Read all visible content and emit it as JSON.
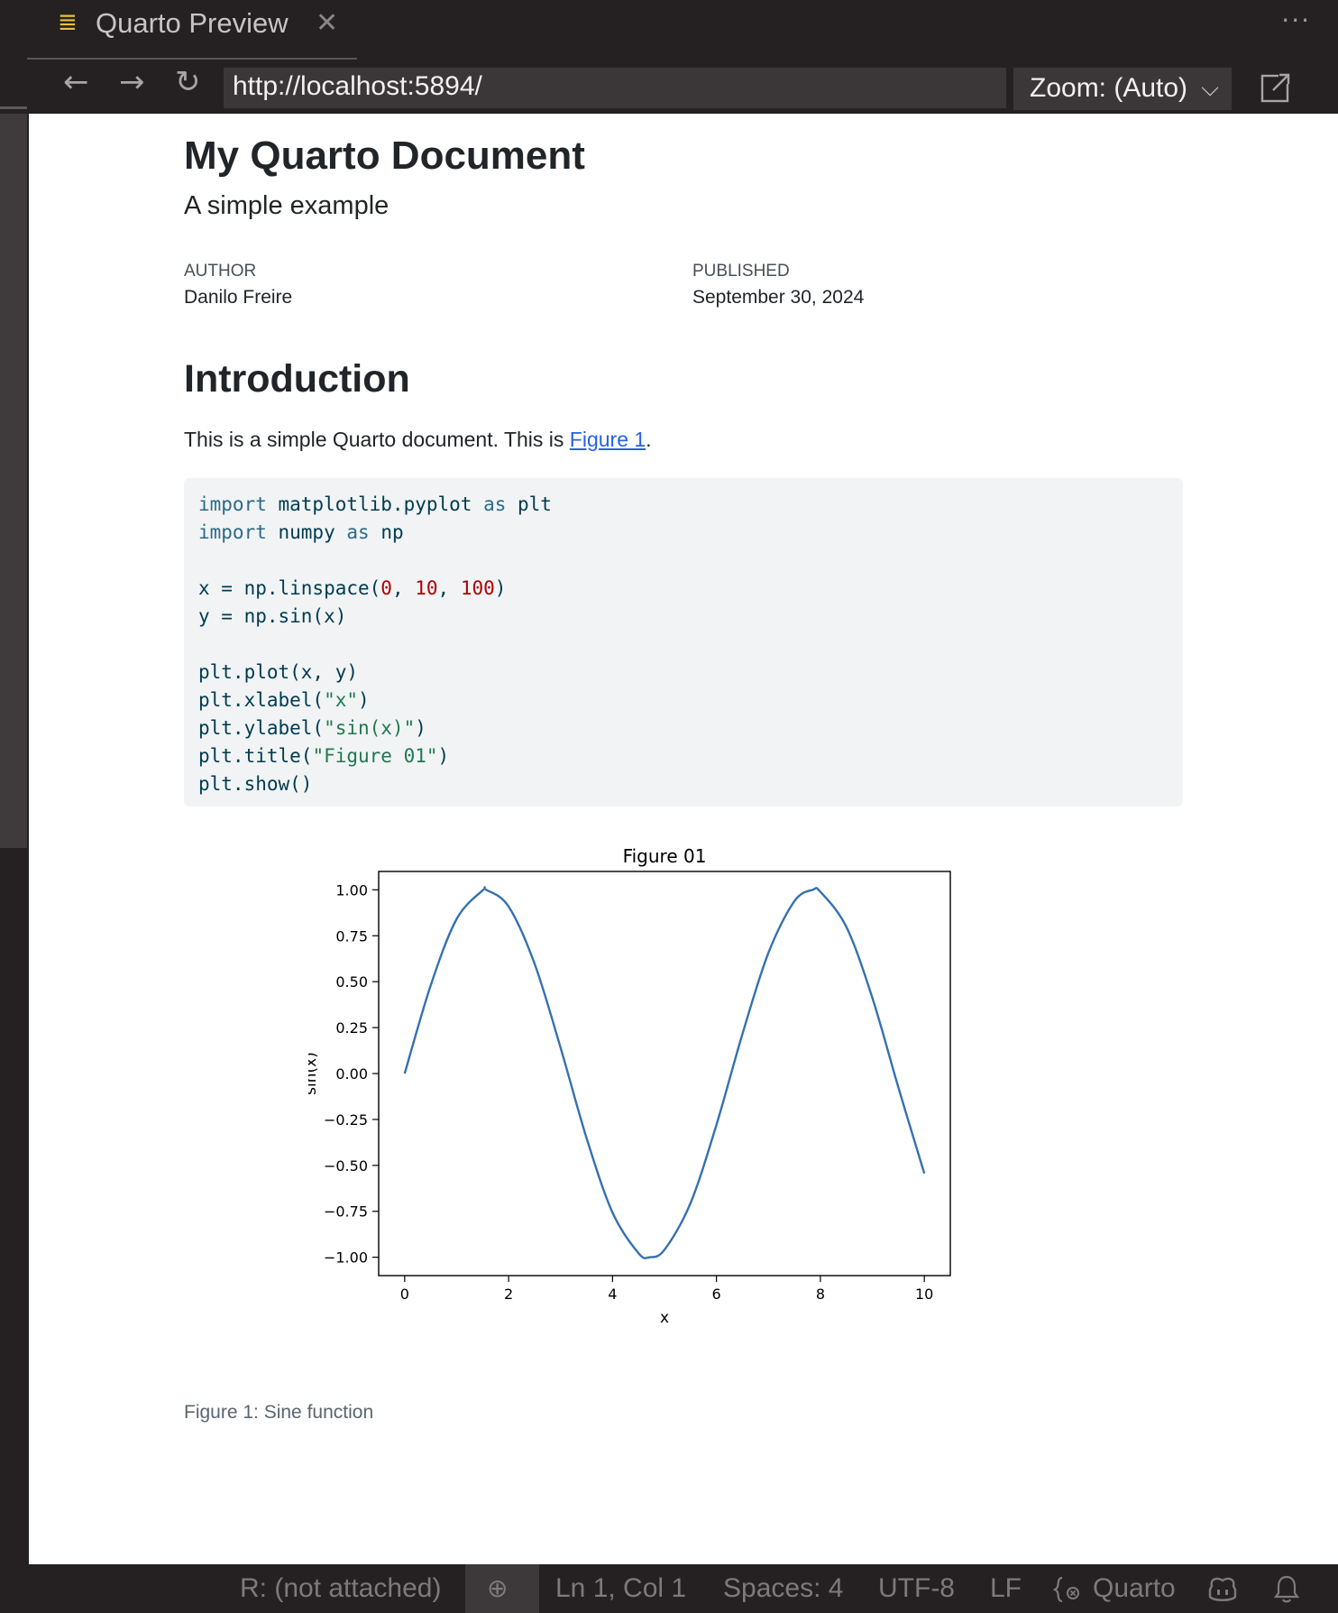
{
  "tab": {
    "icon": "menu-lines-icon",
    "title": "Quarto Preview",
    "close": "✕"
  },
  "toolbar": {
    "more": "···",
    "back": "←",
    "forward": "→",
    "reload": "↻",
    "url": "http://localhost:5894/",
    "zoom_label": "Zoom: (Auto)",
    "zoom_chevron": "⌵",
    "popout_icon": "open-external-icon"
  },
  "document": {
    "title": "My Quarto Document",
    "subtitle": "A simple example",
    "author_label": "AUTHOR",
    "author": "Danilo Freire",
    "published_label": "PUBLISHED",
    "published": "September 30, 2024",
    "section_heading": "Introduction",
    "paragraph_text": "This is a simple Quarto document. This is ",
    "paragraph_link": "Figure 1",
    "paragraph_end": ".",
    "figure_caption": "Figure 1: Sine function"
  },
  "code": {
    "lines": [
      [
        {
          "t": "import",
          "c": "kw"
        },
        {
          "t": " matplotlib.pyplot ",
          "c": ""
        },
        {
          "t": "as",
          "c": "kw"
        },
        {
          "t": " plt",
          "c": ""
        }
      ],
      [
        {
          "t": "import",
          "c": "kw"
        },
        {
          "t": " numpy ",
          "c": ""
        },
        {
          "t": "as",
          "c": "kw"
        },
        {
          "t": " np",
          "c": ""
        }
      ],
      [],
      [
        {
          "t": "x = np.linspace(",
          "c": ""
        },
        {
          "t": "0",
          "c": "num"
        },
        {
          "t": ", ",
          "c": ""
        },
        {
          "t": "10",
          "c": "num"
        },
        {
          "t": ", ",
          "c": ""
        },
        {
          "t": "100",
          "c": "num"
        },
        {
          "t": ")",
          "c": ""
        }
      ],
      [
        {
          "t": "y = np.sin(x)",
          "c": ""
        }
      ],
      [],
      [
        {
          "t": "plt.plot(x, y)",
          "c": ""
        }
      ],
      [
        {
          "t": "plt.xlabel(",
          "c": ""
        },
        {
          "t": "\"x\"",
          "c": "str"
        },
        {
          "t": ")",
          "c": ""
        }
      ],
      [
        {
          "t": "plt.ylabel(",
          "c": ""
        },
        {
          "t": "\"sin(x)\"",
          "c": "str"
        },
        {
          "t": ")",
          "c": ""
        }
      ],
      [
        {
          "t": "plt.title(",
          "c": ""
        },
        {
          "t": "\"Figure 01\"",
          "c": "str"
        },
        {
          "t": ")",
          "c": ""
        }
      ],
      [
        {
          "t": "plt.show()",
          "c": ""
        }
      ]
    ]
  },
  "chart_data": {
    "type": "line",
    "title": "Figure 01",
    "xlabel": "x",
    "ylabel": "sin(x)",
    "xlim": [
      -0.5,
      10.5
    ],
    "ylim": [
      -1.1,
      1.1
    ],
    "xticks": [
      0,
      2,
      4,
      6,
      8,
      10
    ],
    "xtick_labels": [
      "0",
      "2",
      "4",
      "6",
      "8",
      "10"
    ],
    "yticks": [
      1.0,
      0.75,
      0.5,
      0.25,
      0.0,
      -0.25,
      -0.5,
      -0.75,
      -1.0
    ],
    "ytick_labels": [
      "1.00",
      "0.75",
      "0.50",
      "0.25",
      "0.00",
      "−0.25",
      "−0.50",
      "−0.75",
      "−1.00"
    ],
    "grid": false,
    "series": [
      {
        "color": "#3570b1",
        "x": [
          0,
          0.5,
          1,
          1.5,
          1.5708,
          2,
          2.5,
          3,
          3.5,
          4,
          4.5,
          4.7124,
          5,
          5.5,
          6,
          6.5,
          7,
          7.5,
          7.854,
          8,
          8.5,
          9,
          9.5,
          10
        ],
        "y": [
          0,
          0.479,
          0.841,
          0.997,
          1.0,
          0.909,
          0.598,
          0.141,
          -0.351,
          -0.757,
          -0.978,
          -1.0,
          -0.959,
          -0.706,
          -0.279,
          0.215,
          0.657,
          0.938,
          1.0,
          0.989,
          0.798,
          0.412,
          -0.075,
          -0.544
        ]
      }
    ]
  },
  "statusbar": {
    "r_status": "R: (not attached)",
    "zoom_icon": "⊕",
    "position": "Ln 1, Col 1",
    "spaces": "Spaces: 4",
    "encoding": "UTF-8",
    "eol": "LF",
    "language": "Quarto",
    "language_icon": "braces-icon",
    "copilot_icon": "copilot-icon",
    "bell_icon": "bell-icon"
  }
}
